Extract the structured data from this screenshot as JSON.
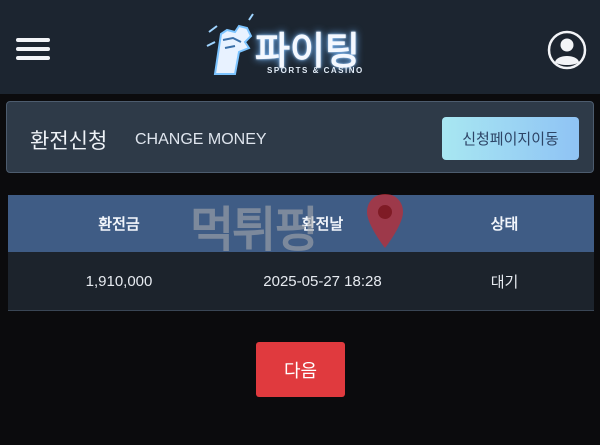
{
  "header": {
    "logo_text": "파이팅",
    "logo_sub": "SPORTS & CASINO",
    "menu_icon": "hamburger-menu-icon",
    "user_icon": "user-account-icon"
  },
  "exchange": {
    "title": "환전신청",
    "subtitle": "CHANGE MONEY",
    "goto_button": "신청페이지이동"
  },
  "table": {
    "headers": [
      "환전금",
      "환전날",
      "상태"
    ],
    "rows": [
      [
        "1,910,000",
        "2025-05-27 18:28",
        "대기"
      ]
    ]
  },
  "watermark": {
    "text": "먹튀핑"
  },
  "next_button": "다음",
  "colors": {
    "header_bg": "#1c2530",
    "table_header_bg": "#3f5c85",
    "next_button_bg": "#e03a3e",
    "goto_button_gradient_start": "#a8e7f2",
    "goto_button_gradient_end": "#8fc3f4"
  }
}
